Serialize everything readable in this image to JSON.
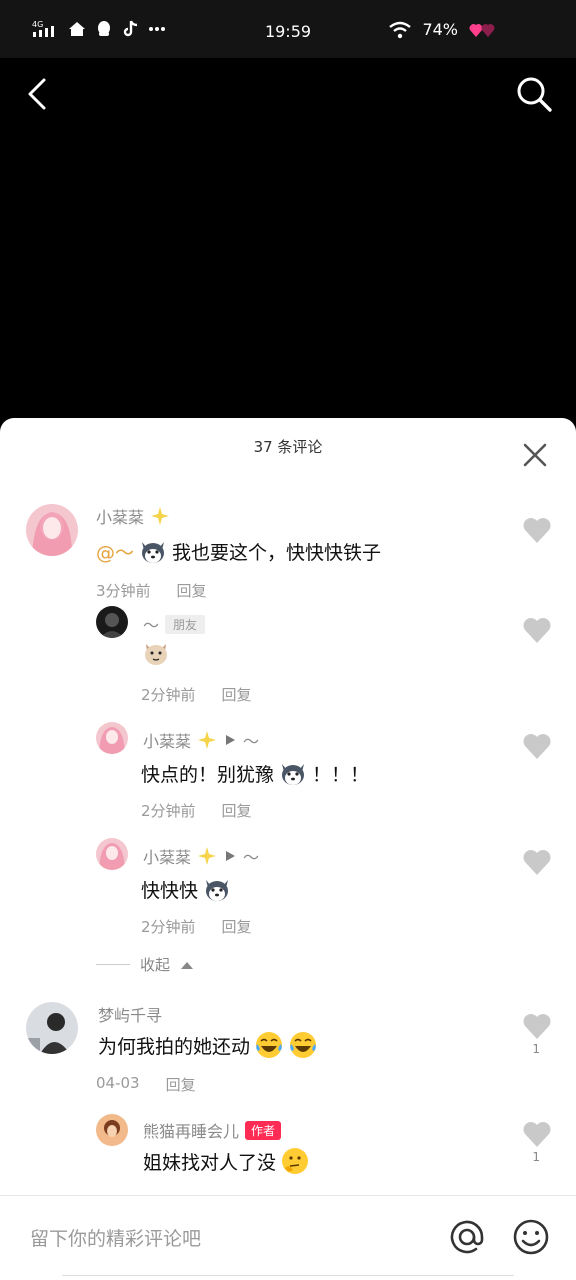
{
  "status": {
    "network": "4G HD",
    "time": "19:59",
    "battery": "74%"
  },
  "sheet": {
    "title": "37 条评论"
  },
  "comments": [
    {
      "user": "小棻棻",
      "mention": "@～",
      "text": "我也要这个，快快快铁子",
      "time": "3分钟前",
      "reply": "回复"
    },
    {
      "user": "～",
      "tag": "朋友",
      "time": "2分钟前",
      "reply": "回复"
    },
    {
      "user": "小棻棻",
      "to": "～",
      "text": "快点的！别犹豫",
      "text_suffix": "！！！",
      "time": "2分钟前",
      "reply": "回复"
    },
    {
      "user": "小棻棻",
      "to": "～",
      "text": "快快快",
      "time": "2分钟前",
      "reply": "回复"
    },
    {
      "user": "梦屿千寻",
      "text": "为何我拍的她还动",
      "time": "04-03",
      "reply": "回复",
      "likes": "1"
    },
    {
      "user": "熊猫再睡会儿",
      "tag": "作者",
      "text": "姐妹找对人了没",
      "likes": "1"
    }
  ],
  "collapse": {
    "label": "收起"
  },
  "input": {
    "placeholder": "留下你的精彩评论吧"
  },
  "colors": {
    "accent": "#fe2c55",
    "mention": "#e6a23c"
  }
}
